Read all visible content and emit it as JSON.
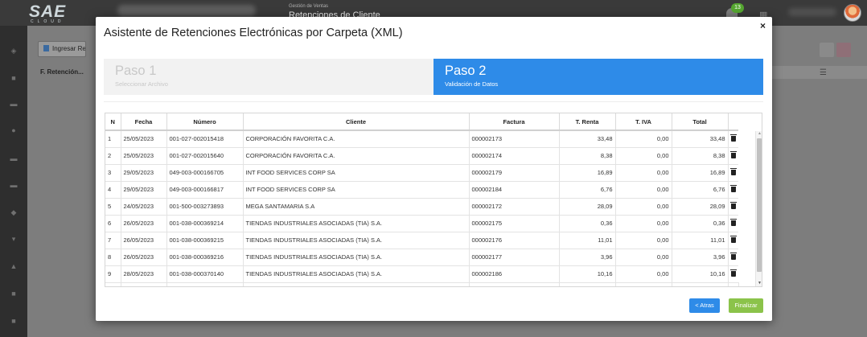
{
  "app": {
    "module_parent": "Gestión de Ventas",
    "module_title": "Retenciones de Cliente",
    "notification_count": "13",
    "toolbar_button": "Ingresar Re",
    "column_header": "F. Retención..."
  },
  "modal": {
    "title": "Asistente de Retenciones Electrónicas por Carpeta (XML)",
    "close_label": "×",
    "steps": [
      {
        "title": "Paso 1",
        "subtitle": "Seleccionar Archivo",
        "active": false
      },
      {
        "title": "Paso 2",
        "subtitle": "Validación de Datos",
        "active": true
      }
    ],
    "columns": [
      "N",
      "Fecha",
      "Número",
      "Cliente",
      "Factura",
      "T. Renta",
      "T. IVA",
      "Total"
    ],
    "rows": [
      {
        "n": "1",
        "fecha": "25/05/2023",
        "numero": "001-027-002015418",
        "cliente": "CORPORACIÓN FAVORITA C.A.",
        "factura": "000002173",
        "renta": "33,48",
        "iva": "0,00",
        "total": "33,48"
      },
      {
        "n": "2",
        "fecha": "25/05/2023",
        "numero": "001-027-002015640",
        "cliente": "CORPORACIÓN FAVORITA C.A.",
        "factura": "000002174",
        "renta": "8,38",
        "iva": "0,00",
        "total": "8,38"
      },
      {
        "n": "3",
        "fecha": "29/05/2023",
        "numero": "049-003-000166705",
        "cliente": "INT FOOD SERVICES CORP SA",
        "factura": "000002179",
        "renta": "16,89",
        "iva": "0,00",
        "total": "16,89"
      },
      {
        "n": "4",
        "fecha": "29/05/2023",
        "numero": "049-003-000166817",
        "cliente": "INT FOOD SERVICES CORP SA",
        "factura": "000002184",
        "renta": "6,76",
        "iva": "0,00",
        "total": "6,76"
      },
      {
        "n": "5",
        "fecha": "24/05/2023",
        "numero": "001-500-003273893",
        "cliente": "MEGA SANTAMARIA S.A",
        "factura": "000002172",
        "renta": "28,09",
        "iva": "0,00",
        "total": "28,09"
      },
      {
        "n": "6",
        "fecha": "26/05/2023",
        "numero": "001-038-000369214",
        "cliente": "TIENDAS INDUSTRIALES ASOCIADAS (TIA) S.A.",
        "factura": "000002175",
        "renta": "0,36",
        "iva": "0,00",
        "total": "0,36"
      },
      {
        "n": "7",
        "fecha": "26/05/2023",
        "numero": "001-038-000369215",
        "cliente": "TIENDAS INDUSTRIALES ASOCIADAS (TIA) S.A.",
        "factura": "000002176",
        "renta": "11,01",
        "iva": "0,00",
        "total": "11,01"
      },
      {
        "n": "8",
        "fecha": "26/05/2023",
        "numero": "001-038-000369216",
        "cliente": "TIENDAS INDUSTRIALES ASOCIADAS (TIA) S.A.",
        "factura": "000002177",
        "renta": "3,96",
        "iva": "0,00",
        "total": "3,96"
      },
      {
        "n": "9",
        "fecha": "28/05/2023",
        "numero": "001-038-000370140",
        "cliente": "TIENDAS INDUSTRIALES ASOCIADAS (TIA) S.A.",
        "factura": "000002186",
        "renta": "10,16",
        "iva": "0,00",
        "total": "10,16"
      }
    ],
    "buttons": {
      "back": "< Atras",
      "finish": "Finalizar"
    }
  },
  "colors": {
    "accent": "#2e8be8",
    "finish": "#8bc34a"
  },
  "icons": [
    "trash-icon",
    "close-icon",
    "filter-icon",
    "bell-icon",
    "apps-icon"
  ]
}
